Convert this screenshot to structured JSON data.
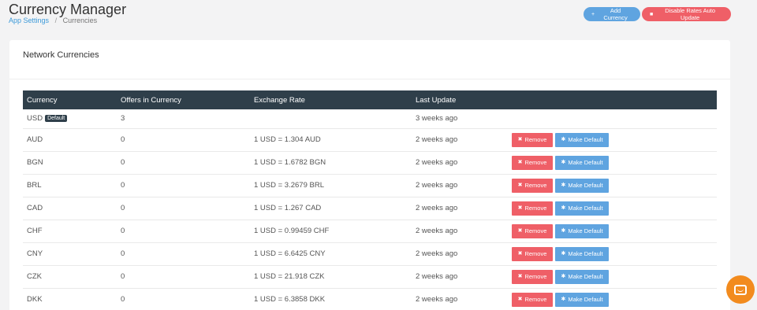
{
  "header": {
    "title": "Currency Manager",
    "breadcrumb": [
      "App Settings",
      "Currencies"
    ],
    "add_currency_label": "Add Currency",
    "disable_auto_update_label": "Disable Rates Auto Update"
  },
  "card": {
    "title": "Network Currencies"
  },
  "table": {
    "columns": [
      "Currency",
      "Offers in Currency",
      "Exchange Rate",
      "Last Update",
      ""
    ],
    "default_badge": "Default",
    "remove_label": "Remove",
    "make_default_label": "Make Default",
    "rows": [
      {
        "currency": "USD",
        "offers": "3",
        "rate": "",
        "updated": "3 weeks ago",
        "is_default": true
      },
      {
        "currency": "AUD",
        "offers": "0",
        "rate": "1 USD = 1.304 AUD",
        "updated": "2 weeks ago"
      },
      {
        "currency": "BGN",
        "offers": "0",
        "rate": "1 USD = 1.6782 BGN",
        "updated": "2 weeks ago"
      },
      {
        "currency": "BRL",
        "offers": "0",
        "rate": "1 USD = 3.2679 BRL",
        "updated": "2 weeks ago"
      },
      {
        "currency": "CAD",
        "offers": "0",
        "rate": "1 USD = 1.267 CAD",
        "updated": "2 weeks ago"
      },
      {
        "currency": "CHF",
        "offers": "0",
        "rate": "1 USD = 0.99459 CHF",
        "updated": "2 weeks ago"
      },
      {
        "currency": "CNY",
        "offers": "0",
        "rate": "1 USD = 6.6425 CNY",
        "updated": "2 weeks ago"
      },
      {
        "currency": "CZK",
        "offers": "0",
        "rate": "1 USD = 21.918 CZK",
        "updated": "2 weeks ago"
      },
      {
        "currency": "DKK",
        "offers": "0",
        "rate": "1 USD = 6.3858 DKK",
        "updated": "2 weeks ago"
      }
    ]
  },
  "icons": {
    "add": "plus-icon",
    "disable": "stop-icon",
    "remove": "close-icon",
    "make_default": "gear-icon",
    "chat": "chat-icon"
  },
  "colors": {
    "primary": "#5fa4e0",
    "danger": "#ef5f67",
    "table_header": "#2f3f4a",
    "chat": "#f28b1e"
  }
}
